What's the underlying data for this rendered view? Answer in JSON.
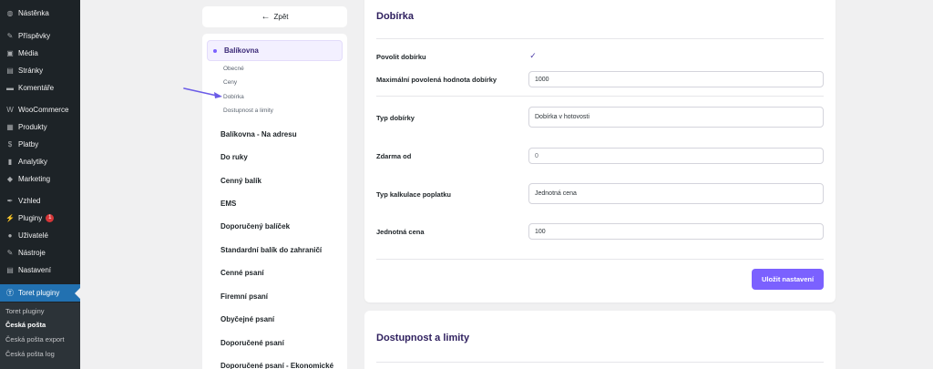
{
  "admin_menu": {
    "items": [
      {
        "icon": "dashboard-icon",
        "glyph": "◍",
        "label": "Nástěnka"
      },
      {
        "icon": "pin-icon",
        "glyph": "✎",
        "label": "Příspěvky"
      },
      {
        "icon": "media-icon",
        "glyph": "▣",
        "label": "Média"
      },
      {
        "icon": "page-icon",
        "glyph": "▤",
        "label": "Stránky"
      },
      {
        "icon": "comment-icon",
        "glyph": "▬",
        "label": "Komentáře"
      },
      {
        "icon": "woocommerce-icon",
        "glyph": "W",
        "label": "WooCommerce"
      },
      {
        "icon": "products-icon",
        "glyph": "▦",
        "label": "Produkty"
      },
      {
        "icon": "payments-icon",
        "glyph": "$",
        "label": "Platby"
      },
      {
        "icon": "analytics-icon",
        "glyph": "▮",
        "label": "Analytiky"
      },
      {
        "icon": "marketing-icon",
        "glyph": "◆",
        "label": "Marketing"
      },
      {
        "icon": "appearance-icon",
        "glyph": "✒",
        "label": "Vzhled"
      },
      {
        "icon": "plugins-icon",
        "glyph": "⚡",
        "label": "Pluginy",
        "badge": "1"
      },
      {
        "icon": "users-icon",
        "glyph": "●",
        "label": "Uživatelé"
      },
      {
        "icon": "tools-icon",
        "glyph": "✎",
        "label": "Nástroje"
      },
      {
        "icon": "settings-icon",
        "glyph": "▤",
        "label": "Nastavení"
      },
      {
        "icon": "toret-icon",
        "glyph": "Ⓣ",
        "label": "Toret pluginy"
      }
    ],
    "submenu": [
      {
        "label": "Toret pluginy"
      },
      {
        "label": "Česká pošta"
      },
      {
        "label": "Česká pošta export"
      },
      {
        "label": "Česká pošta log"
      }
    ]
  },
  "back_button": {
    "arrow": "←",
    "label": "Zpět"
  },
  "nav": {
    "active": "Balíkovna",
    "subitems": [
      "Obecné",
      "Ceny",
      "Dobírka",
      "Dostupnost a limity"
    ],
    "items": [
      "Balíkovna - Na adresu",
      "Do ruky",
      "Cenný balík",
      "EMS",
      "Doporučený balíček",
      "Standardní balík do zahraničí",
      "Cenné psaní",
      "Firemní psaní",
      "Obyčejné psaní",
      "Doporučené psaní",
      "Doporučené psaní - Ekonomické"
    ]
  },
  "form": {
    "title": "Dobírka",
    "enable_label": "Povolit dobírku",
    "enable_checked": true,
    "check_glyph": "✓",
    "max_label": "Maximální povolená hodnota dobírky",
    "max_value": "1000",
    "type_label": "Typ dobírky",
    "type_value": "Dobírka v hotovosti",
    "free_label": "Zdarma od",
    "free_value": "0",
    "calc_label": "Typ kalkulace poplatku",
    "calc_value": "Jednotná cena",
    "price_label": "Jednotná cena",
    "price_value": "100",
    "save_label": "Uložit nastavení"
  },
  "second_card": {
    "title": "Dostupnost a limity"
  },
  "colors": {
    "accent": "#7b61ff",
    "wp_sidebar": "#1d2327",
    "wp_active": "#2271b1",
    "badge": "#d63638"
  }
}
